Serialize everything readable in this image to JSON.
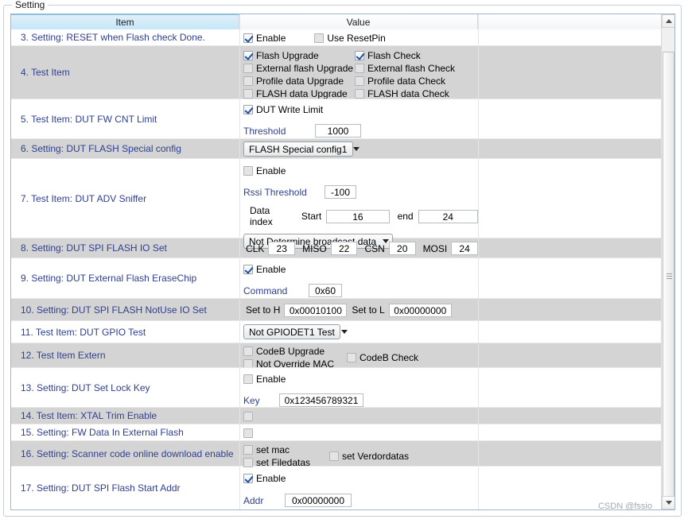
{
  "groupbox": {
    "legend": "Setting"
  },
  "columns": {
    "item": "Item",
    "value": "Value",
    "extra": ""
  },
  "watermark": "CSDN @fssio",
  "colors": {
    "item_text": "#2f3f8f",
    "alt_row": "#d4d4d4",
    "header_selected": "#c7e7f7",
    "grid_border": "#9fb6cd"
  },
  "rows": [
    {
      "item": "3. Setting: RESET when Flash check Done.",
      "checks": [
        {
          "label": "Enable",
          "checked": true
        },
        {
          "label": "Use ResetPin",
          "checked": false
        }
      ]
    },
    {
      "item": "4. Test Item",
      "checks_left": [
        {
          "label": "Flash Upgrade",
          "checked": true
        },
        {
          "label": "External flash Upgrade",
          "checked": false
        },
        {
          "label": "Profile data Upgrade",
          "checked": false
        },
        {
          "label": "FLASH data Upgrade",
          "checked": false
        }
      ],
      "checks_right": [
        {
          "label": "Flash Check",
          "checked": true
        },
        {
          "label": "External flash Check",
          "checked": false
        },
        {
          "label": "Profile data Check",
          "checked": false
        },
        {
          "label": "FLASH data Check",
          "checked": false
        }
      ]
    },
    {
      "item": "5. Test Item: DUT FW CNT Limit",
      "check": {
        "label": "DUT Write Limit",
        "checked": true
      },
      "field_label": "Threshold",
      "field_value": "1000"
    },
    {
      "item": "6. Setting: DUT FLASH Special config",
      "combo": "FLASH Special config1"
    },
    {
      "item": "7. Test Item: DUT ADV Sniffer",
      "check": {
        "label": "Enable",
        "checked": false
      },
      "rssi_label": "Rssi Threshold",
      "rssi_value": "-100",
      "data_index_label": "Data index",
      "start_label": "Start",
      "start_value": "16",
      "end_label": "end",
      "end_value": "24",
      "combo": "Not Determine broadcast data"
    },
    {
      "item": "8. Setting: DUT SPI FLASH IO Set",
      "pins": [
        {
          "label": "CLK",
          "value": "23"
        },
        {
          "label": "MISO",
          "value": "22"
        },
        {
          "label": "CSN",
          "value": "20"
        },
        {
          "label": "MOSI",
          "value": "24"
        }
      ]
    },
    {
      "item": "9. Setting: DUT External Flash EraseChip",
      "check": {
        "label": "Enable",
        "checked": true
      },
      "field_label": "Command",
      "field_value": "0x60"
    },
    {
      "item": "10. Setting: DUT SPI FLASH NotUse IO Set",
      "seth_label": "Set to H",
      "seth_value": "0x00010100",
      "setl_label": "Set to L",
      "setl_value": "0x00000000"
    },
    {
      "item": "11. Test Item: DUT GPIO Test",
      "combo": "Not GPIODET1 Test"
    },
    {
      "item": "12. Test Item Extern",
      "checks_left": [
        {
          "label": "CodeB Upgrade",
          "checked": false
        },
        {
          "label": "Not Override MAC",
          "checked": false
        }
      ],
      "checks_right": [
        {
          "label": "CodeB Check",
          "checked": false
        }
      ]
    },
    {
      "item": "13. Setting: DUT Set Lock Key",
      "check": {
        "label": "Enable",
        "checked": false
      },
      "field_label": "Key",
      "field_value": "0x123456789321"
    },
    {
      "item": "14. Test Item: XTAL Trim Enable",
      "check": {
        "label": "",
        "checked": false
      }
    },
    {
      "item": "15. Setting: FW Data In External Flash",
      "check": {
        "label": "",
        "checked": false
      }
    },
    {
      "item": "16. Setting: Scanner code online download enable",
      "checks_left": [
        {
          "label": "set mac",
          "checked": false
        },
        {
          "label": "set Filedatas",
          "checked": false
        }
      ],
      "checks_right": [
        {
          "label": "set Verdordatas",
          "checked": false
        }
      ]
    },
    {
      "item": "17. Setting: DUT SPI Flash Start Addr",
      "check": {
        "label": "Enable",
        "checked": true
      },
      "field_label": "Addr",
      "field_value": "0x00000000"
    }
  ]
}
